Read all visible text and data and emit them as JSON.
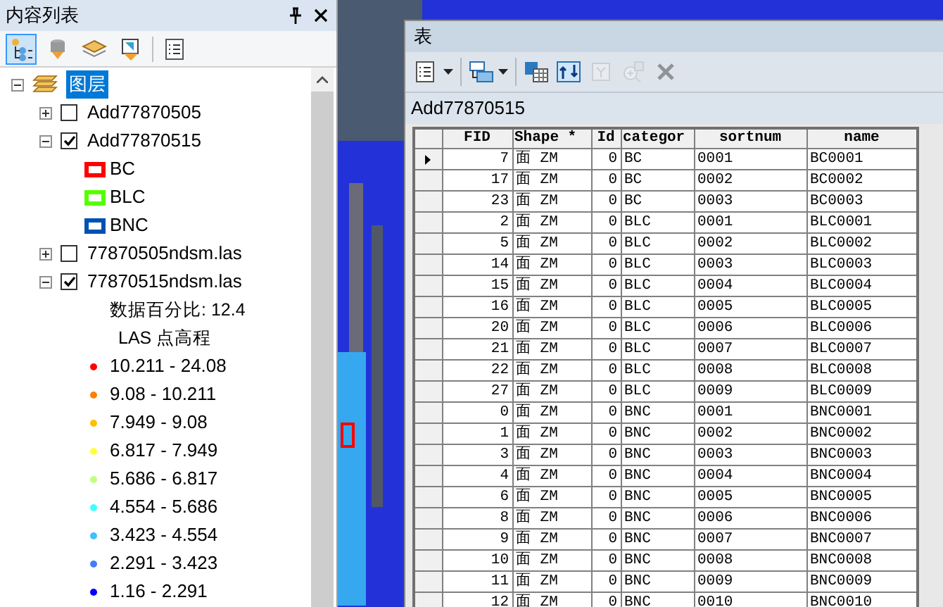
{
  "toc": {
    "title": "内容列表",
    "toolbar": [
      {
        "kind": "drawing-order",
        "selected": true
      },
      {
        "kind": "source",
        "selected": false
      },
      {
        "kind": "visibility",
        "selected": false
      },
      {
        "kind": "selection",
        "selected": false
      },
      {
        "kind": "options",
        "selected": false
      }
    ],
    "tree": {
      "label": "图层",
      "selected": true,
      "expanded": true,
      "children": [
        {
          "label": "Add77870505",
          "expanded": false,
          "checked": false
        },
        {
          "label": "Add77870515",
          "expanded": true,
          "checked": true,
          "legend": [
            {
              "kind": "polygon",
              "label": "BC",
              "color": "#ff0000"
            },
            {
              "kind": "polygon",
              "label": "BLC",
              "color": "#55ff00"
            },
            {
              "kind": "polygon",
              "label": "BNC",
              "color": "#0050b4"
            }
          ]
        },
        {
          "label": "77870505ndsm.las",
          "expanded": false,
          "checked": false
        },
        {
          "label": "77870515ndsm.las",
          "expanded": true,
          "checked": true,
          "notes": [
            "数据百分比: 12.4",
            "LAS 点高程"
          ],
          "legend": [
            {
              "kind": "point",
              "label": "10.211 - 24.08",
              "color": "#ff0000"
            },
            {
              "kind": "point",
              "label": "9.08 - 10.211",
              "color": "#ff7f00"
            },
            {
              "kind": "point",
              "label": "7.949 - 9.08",
              "color": "#ffbf00"
            },
            {
              "kind": "point",
              "label": "6.817 - 7.949",
              "color": "#ffff3f"
            },
            {
              "kind": "point",
              "label": "5.686 - 6.817",
              "color": "#bfff7f"
            },
            {
              "kind": "point",
              "label": "4.554 - 5.686",
              "color": "#3fffff"
            },
            {
              "kind": "point",
              "label": "3.423 - 4.554",
              "color": "#3fbfff"
            },
            {
              "kind": "point",
              "label": "2.291 - 3.423",
              "color": "#3f7fff"
            },
            {
              "kind": "point",
              "label": "1.16 - 2.291",
              "color": "#0000ff"
            }
          ]
        }
      ]
    }
  },
  "table_window": {
    "title": "表",
    "toolbar": [
      {
        "kind": "table-options",
        "dropdown": true,
        "disabled": false
      },
      {
        "kind": "related-tables",
        "dropdown": true,
        "disabled": false
      },
      {
        "kind": "select-by-attributes",
        "dropdown": false,
        "disabled": false
      },
      {
        "kind": "switch-selection",
        "dropdown": false,
        "disabled": false
      },
      {
        "kind": "clear-selection",
        "dropdown": false,
        "disabled": true
      },
      {
        "kind": "zoom-to-selected",
        "dropdown": false,
        "disabled": true
      },
      {
        "kind": "delete-selected",
        "dropdown": false,
        "disabled": true
      }
    ],
    "layer_name": "Add77870515",
    "columns": [
      "FID",
      "Shape *",
      "Id",
      "categor",
      "sortnum",
      "name"
    ],
    "rows": [
      {
        "selected": true,
        "cells": [
          "7",
          "面 ZM",
          "0",
          "BC",
          "0001",
          "BC0001"
        ]
      },
      {
        "selected": false,
        "cells": [
          "17",
          "面 ZM",
          "0",
          "BC",
          "0002",
          "BC0002"
        ]
      },
      {
        "selected": false,
        "cells": [
          "23",
          "面 ZM",
          "0",
          "BC",
          "0003",
          "BC0003"
        ]
      },
      {
        "selected": false,
        "cells": [
          "2",
          "面 ZM",
          "0",
          "BLC",
          "0001",
          "BLC0001"
        ]
      },
      {
        "selected": false,
        "cells": [
          "5",
          "面 ZM",
          "0",
          "BLC",
          "0002",
          "BLC0002"
        ]
      },
      {
        "selected": false,
        "cells": [
          "14",
          "面 ZM",
          "0",
          "BLC",
          "0003",
          "BLC0003"
        ]
      },
      {
        "selected": false,
        "cells": [
          "15",
          "面 ZM",
          "0",
          "BLC",
          "0004",
          "BLC0004"
        ]
      },
      {
        "selected": false,
        "cells": [
          "16",
          "面 ZM",
          "0",
          "BLC",
          "0005",
          "BLC0005"
        ]
      },
      {
        "selected": false,
        "cells": [
          "20",
          "面 ZM",
          "0",
          "BLC",
          "0006",
          "BLC0006"
        ]
      },
      {
        "selected": false,
        "cells": [
          "21",
          "面 ZM",
          "0",
          "BLC",
          "0007",
          "BLC0007"
        ]
      },
      {
        "selected": false,
        "cells": [
          "22",
          "面 ZM",
          "0",
          "BLC",
          "0008",
          "BLC0008"
        ]
      },
      {
        "selected": false,
        "cells": [
          "27",
          "面 ZM",
          "0",
          "BLC",
          "0009",
          "BLC0009"
        ]
      },
      {
        "selected": false,
        "cells": [
          "0",
          "面 ZM",
          "0",
          "BNC",
          "0001",
          "BNC0001"
        ]
      },
      {
        "selected": false,
        "cells": [
          "1",
          "面 ZM",
          "0",
          "BNC",
          "0002",
          "BNC0002"
        ]
      },
      {
        "selected": false,
        "cells": [
          "3",
          "面 ZM",
          "0",
          "BNC",
          "0003",
          "BNC0003"
        ]
      },
      {
        "selected": false,
        "cells": [
          "4",
          "面 ZM",
          "0",
          "BNC",
          "0004",
          "BNC0004"
        ]
      },
      {
        "selected": false,
        "cells": [
          "6",
          "面 ZM",
          "0",
          "BNC",
          "0005",
          "BNC0005"
        ]
      },
      {
        "selected": false,
        "cells": [
          "8",
          "面 ZM",
          "0",
          "BNC",
          "0006",
          "BNC0006"
        ]
      },
      {
        "selected": false,
        "cells": [
          "9",
          "面 ZM",
          "0",
          "BNC",
          "0007",
          "BNC0007"
        ]
      },
      {
        "selected": false,
        "cells": [
          "10",
          "面 ZM",
          "0",
          "BNC",
          "0008",
          "BNC0008"
        ]
      },
      {
        "selected": false,
        "cells": [
          "11",
          "面 ZM",
          "0",
          "BNC",
          "0009",
          "BNC0009"
        ]
      },
      {
        "selected": false,
        "cells": [
          "12",
          "面 ZM",
          "0",
          "BNC",
          "0010",
          "BNC0010"
        ]
      }
    ]
  }
}
